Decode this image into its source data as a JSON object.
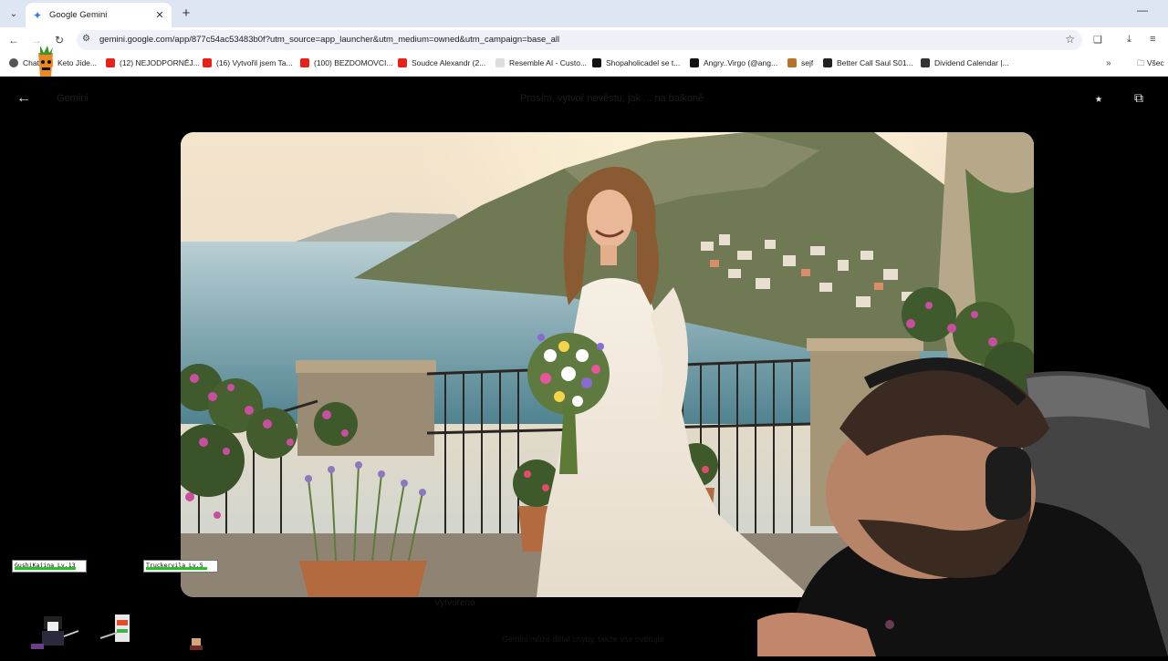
{
  "browser": {
    "tab": {
      "title": "Google Gemini"
    },
    "url": "gemini.google.com/app/877c54ac53483b0f?utm_source=app_launcher&utm_medium=owned&utm_campaign=base_all",
    "bookmarks": [
      {
        "label": "Chat",
        "kind": "site"
      },
      {
        "label": "Keto Jíde...",
        "kind": "site"
      },
      {
        "label": "(12) NEJODPORNĚJ...",
        "kind": "youtube"
      },
      {
        "label": "(16) Vytvořil jsem Ta...",
        "kind": "youtube"
      },
      {
        "label": "(100) BEZDOMOVCI...",
        "kind": "youtube"
      },
      {
        "label": "Soudce Alexandr (2...",
        "kind": "youtube"
      },
      {
        "label": "Resemble AI - Custo...",
        "kind": "site"
      },
      {
        "label": "Shopaholicadel se t...",
        "kind": "site"
      },
      {
        "label": "Angry..Virgo (@ang...",
        "kind": "site"
      },
      {
        "label": "sejf",
        "kind": "site"
      },
      {
        "label": "Better Call Saul S01...",
        "kind": "site"
      },
      {
        "label": "Dividend Calendar |...",
        "kind": "site"
      }
    ],
    "bookmarks_more": "»",
    "bookmarks_folder": "Všec"
  },
  "viewer": {
    "left_faint": "Gemini",
    "title_faint": "Prosím, vytvoř nevěstu, jak ... na balkoně",
    "caption_faint": "Vytvořeno",
    "bottom_faint": "Gemini může dělat chyby, takže vše ověřujte"
  },
  "overlay": {
    "players": [
      {
        "name": "GushiKajina",
        "level": "Lv.13",
        "hp": 0.9
      },
      {
        "name": "Truckervila",
        "level": "Lv.5",
        "hp": 0.9
      }
    ]
  },
  "colors": {
    "tabbar": "#dfe6f3",
    "omnibox": "#eef1f8",
    "viewer_bg": "#000000",
    "youtube_red": "#e62117"
  }
}
